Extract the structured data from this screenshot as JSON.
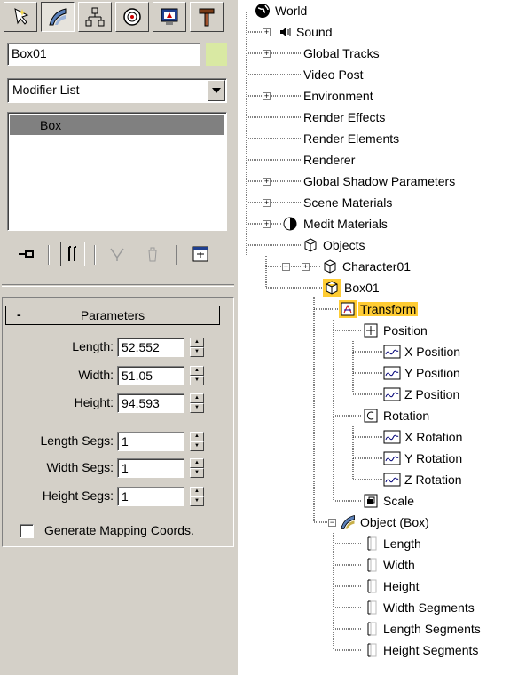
{
  "command_panel": {
    "tabs": [
      {
        "name": "create-tab",
        "icon": "create-icon"
      },
      {
        "name": "modify-tab",
        "icon": "modify-icon"
      },
      {
        "name": "hierarchy-tab",
        "icon": "hierarchy-icon"
      },
      {
        "name": "motion-tab",
        "icon": "motion-icon"
      },
      {
        "name": "display-tab",
        "icon": "display-icon"
      },
      {
        "name": "utilities-tab",
        "icon": "utilities-icon"
      }
    ],
    "object_name": "Box01",
    "object_color": "#d9e9a3",
    "modifier_list_label": "Modifier List",
    "stack_items": [
      "Box"
    ],
    "stack_tools": [
      "pin-stack-icon",
      "show-end-result-icon",
      "make-unique-icon",
      "remove-modifier-icon",
      "configure-modifier-sets-icon"
    ],
    "rollout": {
      "collapse_symbol": "-",
      "title": "Parameters",
      "params": [
        {
          "label": "Length:",
          "value": "52.552"
        },
        {
          "label": "Width:",
          "value": "51.05"
        },
        {
          "label": "Height:",
          "value": "94.593"
        },
        {
          "label": "Length Segs:",
          "value": "1"
        },
        {
          "label": "Width Segs:",
          "value": "1"
        },
        {
          "label": "Height Segs:",
          "value": "1"
        }
      ],
      "generate_mapping": {
        "label": "Generate Mapping Coords.",
        "checked": false
      }
    }
  },
  "track_view": {
    "nodes": [
      {
        "label": "World"
      },
      {
        "label": "Sound"
      },
      {
        "label": "Global Tracks"
      },
      {
        "label": "Video Post"
      },
      {
        "label": "Environment"
      },
      {
        "label": "Render Effects"
      },
      {
        "label": "Render Elements"
      },
      {
        "label": "Renderer"
      },
      {
        "label": "Global Shadow Parameters"
      },
      {
        "label": "Scene Materials"
      },
      {
        "label": "Medit Materials"
      },
      {
        "label": "Objects"
      },
      {
        "label": "Character01"
      },
      {
        "label": "Box01"
      },
      {
        "label": "Transform",
        "selected": true
      },
      {
        "label": "Position"
      },
      {
        "label": "X Position"
      },
      {
        "label": "Y Position"
      },
      {
        "label": "Z Position"
      },
      {
        "label": "Rotation"
      },
      {
        "label": "X Rotation"
      },
      {
        "label": "Y Rotation"
      },
      {
        "label": "Z Rotation"
      },
      {
        "label": "Scale"
      },
      {
        "label": "Object (Box)"
      },
      {
        "label": "Length"
      },
      {
        "label": "Width"
      },
      {
        "label": "Height"
      },
      {
        "label": "Width Segments"
      },
      {
        "label": "Length Segments"
      },
      {
        "label": "Height Segments"
      }
    ],
    "selection_color": "#ffcc33"
  }
}
